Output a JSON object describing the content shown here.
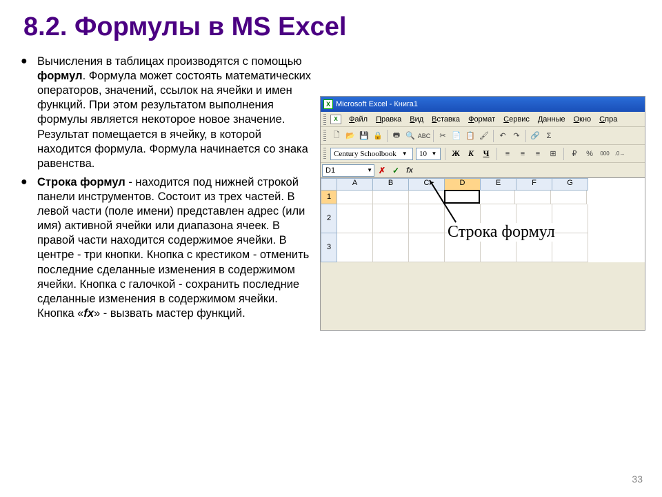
{
  "title": "8.2. Формулы в MS Excel",
  "bullets": [
    {
      "pre": "Вычисления в таблицах производятся с помощью ",
      "bold1": "формул",
      "mid1": ". Формула может состоять математических операторов, значений, ссылок на ячейки и имен функций. При этом результатом выполнения формулы является некоторое новое значение. Результат помещается в ячейку, в которой находится формула. Формула начинается со знака равенства.",
      "bold2": "",
      "mid2": "",
      "ital": "",
      "tail": ""
    },
    {
      "pre": "",
      "bold1": "Строка формул",
      "mid1": " - находится под нижней строкой панели инструментов. Состоит из трех частей. В левой части (поле имени) представлен адрес (или имя) активной ячейки или диапазона ячеек. В правой части находится содержимое ячейки. В центре - три кнопки. Кнопка с крестиком - отменить последние сделанные изменения в содержимом ячейки. Кнопка с галочкой - сохранить последние сделанные изменения в содержимом ячейки. Кнопка «",
      "bold2": "",
      "mid2": "",
      "ital": "fx",
      "tail": "» - вызвать мастер функций."
    }
  ],
  "excel": {
    "titlebar": "Microsoft Excel - Книга1",
    "menu": [
      "Файл",
      "Правка",
      "Вид",
      "Вставка",
      "Формат",
      "Сервис",
      "Данные",
      "Окно",
      "Спра"
    ],
    "font_name": "Century Schoolbook",
    "font_size": "10",
    "style": {
      "bold": "Ж",
      "italic": "К",
      "under": "Ч"
    },
    "namebox": "D1",
    "cancel": "✗",
    "ok": "✓",
    "fx": "fx",
    "columns": [
      "A",
      "B",
      "C",
      "D",
      "E",
      "F",
      "G"
    ],
    "rows": [
      "1",
      "2",
      "3"
    ],
    "percent": "%",
    "thousand": "000",
    "merge": "⊞",
    "annotation": "Строка формул"
  },
  "page_number": "33"
}
